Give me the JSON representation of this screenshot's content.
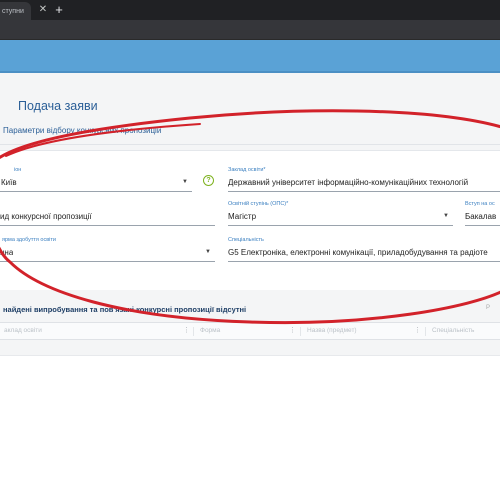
{
  "browser": {
    "tab_title": "ступни",
    "close_glyph": "✕",
    "new_tab_glyph": "+"
  },
  "page": {
    "title": "Подача заяви",
    "section_title": "Параметри відбору конкурсних пропозицій"
  },
  "form": {
    "region": {
      "label": "іон",
      "value": "Київ"
    },
    "institution": {
      "label": "Заклад освіти*",
      "value": "Державний університет інформаційно-комунікаційних технологій"
    },
    "offer_search": {
      "value": "ид конкурсної пропозиції"
    },
    "degree": {
      "label": "Освітній ступінь (ОПС)*",
      "value": "Магістр"
    },
    "entry_basis": {
      "label": "Вступ на ос",
      "value": "Бакалав"
    },
    "study_form": {
      "label": "ярма здобуття освіти",
      "value": "нна"
    },
    "specialty": {
      "label": "Спеціальність",
      "value": "G5 Електроніка, електронні комунікації, приладобудування та радіоте"
    },
    "help_glyph": "?"
  },
  "results": {
    "message": "найдені випробування та пов'язані конкурсні пропозиції відсутні",
    "right_hint": "Р",
    "columns": [
      "аклад освіти",
      "Форма",
      "Назва (предмет)",
      "Спеціальність"
    ],
    "menu_glyph": "⋮"
  },
  "colors": {
    "banner": "#5aa2d6",
    "title": "#2b5f97",
    "label": "#3a7fc0",
    "annotation": "#d2222a",
    "help": "#7fb321"
  }
}
